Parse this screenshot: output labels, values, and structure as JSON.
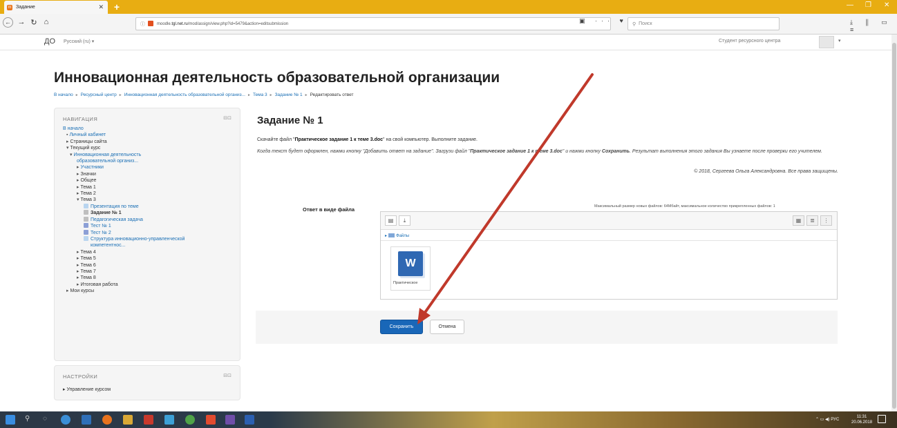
{
  "browser": {
    "tab_title": "Задание",
    "new_tab": "+",
    "url_prefix": "moodle.",
    "url_host": "tgl.net.ru",
    "url_path": "/mod/assign/view.php?id=5479&action=editsubmission",
    "search_placeholder": "Поиск"
  },
  "moodle": {
    "brand": "ДО",
    "language": "Русский ‎(ru)‎ ▾",
    "user_name": "Студент ресурсного центра",
    "page_title": "Инновационная деятельность образовательной организации",
    "breadcrumbs": [
      "В начало",
      "Ресурсный центр",
      "Инновационная деятельность образовательной организ...",
      "Тема 3",
      "Задание № 1",
      "Редактировать ответ"
    ],
    "nav": {
      "header": "НАВИГАЦИЯ",
      "items": [
        {
          "text": "В начало",
          "level": 0,
          "prefix": "",
          "link": true
        },
        {
          "text": "Личный кабинет",
          "level": 1,
          "prefix": "▪ ",
          "link": true
        },
        {
          "text": "Страницы сайта",
          "level": 1,
          "prefix": "▸ ",
          "link": false
        },
        {
          "text": "Текущий курс",
          "level": 1,
          "prefix": "▾ ",
          "link": false
        },
        {
          "text": "Инновационная деятельность",
          "level": 2,
          "prefix": "▾ ",
          "link": true
        },
        {
          "text": "образовательной организ...",
          "level": 3,
          "prefix": "",
          "link": true
        },
        {
          "text": "Участники",
          "level": 3,
          "prefix": "▸ ",
          "link": true
        },
        {
          "text": "Значки",
          "level": 3,
          "prefix": "▸ ",
          "link": false
        },
        {
          "text": "Общее",
          "level": 3,
          "prefix": "▸ ",
          "link": false
        },
        {
          "text": "Тема 1",
          "level": 3,
          "prefix": "▸ ",
          "link": false
        },
        {
          "text": "Тема 2",
          "level": 3,
          "prefix": "▸ ",
          "link": false
        },
        {
          "text": "Тема 3",
          "level": 3,
          "prefix": "▾ ",
          "link": false
        },
        {
          "text": "Презентация по теме",
          "level": 4,
          "prefix": "",
          "link": true,
          "icon": "doc"
        },
        {
          "text": "Задание № 1",
          "level": 4,
          "prefix": "",
          "link": false,
          "bold": true,
          "icon": "asg"
        },
        {
          "text": "Педагогическая задача",
          "level": 4,
          "prefix": "",
          "link": true,
          "icon": "asg"
        },
        {
          "text": "Тест № 1",
          "level": 4,
          "prefix": "",
          "link": true,
          "icon": "quiz"
        },
        {
          "text": "Тест № 2",
          "level": 4,
          "prefix": "",
          "link": true,
          "icon": "quiz"
        },
        {
          "text": "Структура инновационно-управленческой",
          "level": 4,
          "prefix": "",
          "link": true,
          "icon": "pdf"
        },
        {
          "text": "компетентнос...",
          "level": 4,
          "prefix": "",
          "link": true,
          "indent_extra": true
        },
        {
          "text": "Тема 4",
          "level": 3,
          "prefix": "▸ ",
          "link": false
        },
        {
          "text": "Тема 5",
          "level": 3,
          "prefix": "▸ ",
          "link": false
        },
        {
          "text": "Тема 6",
          "level": 3,
          "prefix": "▸ ",
          "link": false
        },
        {
          "text": "Тема 7",
          "level": 3,
          "prefix": "▸ ",
          "link": false
        },
        {
          "text": "Тема 8",
          "level": 3,
          "prefix": "▸ ",
          "link": false
        },
        {
          "text": "Итоговая работа",
          "level": 3,
          "prefix": "▸ ",
          "link": false
        },
        {
          "text": "Мои курсы",
          "level": 1,
          "prefix": "▸ ",
          "link": false
        }
      ]
    },
    "settings": {
      "header": "НАСТРОЙКИ",
      "item": "▸ Управление курсом"
    },
    "assignment": {
      "title": "Задание № 1",
      "intro_a": "Скачайте файл \"",
      "intro_bold": "Практическое задание 1 к теме 3.doc",
      "intro_b": "\" на свой компьютер. Выполните задание.",
      "instructions_a": "Когда текст будет оформлен, нажми кнопку \"Добавить ответ на задание\". Загрузи файл \"",
      "instructions_bold": "Практическое задание 1 к теме 3.doc",
      "instructions_b": "\" и нажми кнопку ",
      "instructions_bold2": "Сохранить",
      "instructions_c": ". Результат выполнения этого задания Вы узнаете после проверки его учителем.",
      "copyright": "© 2018, Сергеева Ольга Александровна. Все права защищены."
    },
    "submission": {
      "label": "Ответ в виде файла",
      "limits": "Максимальный размер новых файлов: 64Мбайт, максимальное количество прикрепленных файлов: 1",
      "path": "Файлы",
      "file_name": "Практическое",
      "file_icon_letter": "W",
      "save_label": "Сохранить",
      "cancel_label": "Отмена"
    }
  },
  "annotation": {
    "arrow_color": "#c0392b"
  }
}
